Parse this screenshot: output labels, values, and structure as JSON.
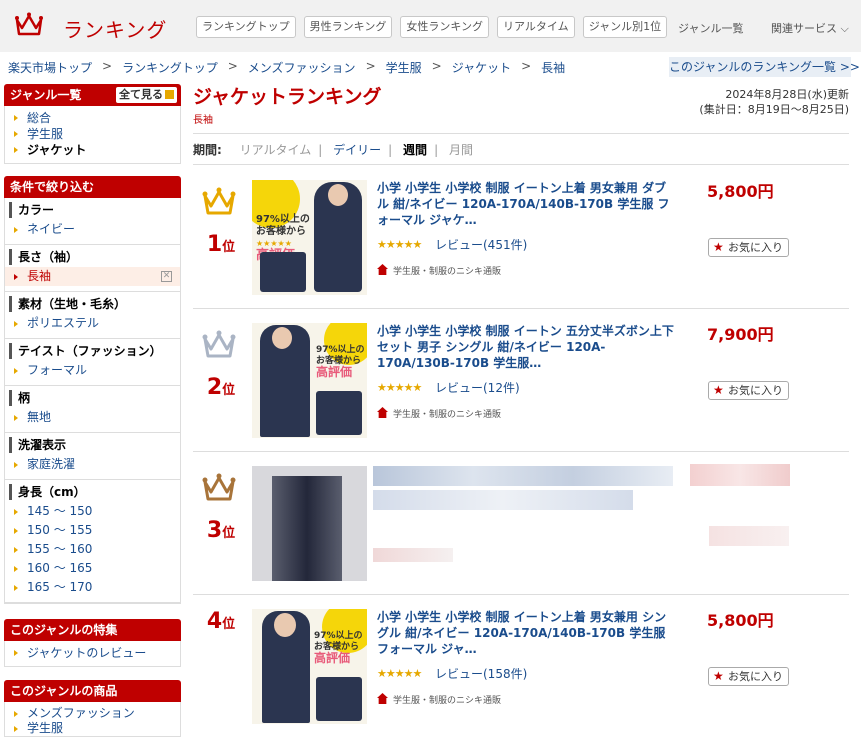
{
  "header": {
    "logo_text": "ランキング",
    "nav": [
      "ランキングトップ",
      "男性ランキング",
      "女性ランキング",
      "リアルタイム",
      "ジャンル別1位"
    ],
    "genre_list": "ジャンル一覧",
    "related": "関連サービス"
  },
  "breadcrumb": [
    "楽天市場トップ",
    "ランキングトップ",
    "メンズファッション",
    "学生服",
    "ジャケット",
    "長袖"
  ],
  "genre_rank_list_button": "このジャンルのランキング一覧 >>",
  "sidebar": {
    "genre_header": "ジャンル一覧",
    "see_all": "全て見る",
    "genres": [
      "総合",
      "学生服",
      "ジャケット"
    ],
    "filter_header": "条件で絞り込む",
    "filters": [
      {
        "title": "カラー",
        "items": [
          "ネイビー"
        ]
      },
      {
        "title": "長さ（袖）",
        "items": [
          "長袖"
        ]
      },
      {
        "title": "素材（生地・毛糸）",
        "items": [
          "ポリエステル"
        ]
      },
      {
        "title": "テイスト（ファッション）",
        "items": [
          "フォーマル"
        ]
      },
      {
        "title": "柄",
        "items": [
          "無地"
        ]
      },
      {
        "title": "洗濯表示",
        "items": [
          "家庭洗濯"
        ]
      },
      {
        "title": "身長（cm）",
        "items": [
          "145 ～ 150",
          "150 ～ 155",
          "155 ～ 160",
          "160 ～ 165",
          "165 ～ 170"
        ]
      }
    ],
    "special_header": "このジャンルの特集",
    "special_items": [
      "ジャケットのレビュー"
    ],
    "products_header": "このジャンルの商品",
    "products_items": [
      "メンズファッション",
      "学生服"
    ]
  },
  "main": {
    "title": "ジャケットランキング",
    "subtitle": "長袖",
    "updated": "2024年8月28日(水)更新",
    "aggregation": "(集計日：8月19日～8月25日)",
    "period_label": "期間:",
    "periods": [
      "リアルタイム",
      "デイリー",
      "週間",
      "月間"
    ],
    "items": [
      {
        "rank": "1",
        "rank_suffix": "位",
        "title": "小学 小学生 小学校 制服 イートン上着 男女兼用 ダブル 紺/ネイビー 120A-170A/140B-170B 学生服 フォーマル ジャケ…",
        "reviews": "レビュー(451件)",
        "shop": "学生服・制服のニシキ通販",
        "price": "5,800円",
        "fav": "お気に入り"
      },
      {
        "rank": "2",
        "rank_suffix": "位",
        "title": "小学 小学生 小学校 制服 イートン 五分丈半ズボン上下セット 男子 シングル 紺/ネイビー 120A-170A/130B-170B 学生服…",
        "reviews": "レビュー(12件)",
        "shop": "学生服・制服のニシキ通販",
        "price": "7,900円",
        "fav": "お気に入り"
      },
      {
        "rank": "3",
        "rank_suffix": "位"
      },
      {
        "rank": "4",
        "rank_suffix": "位",
        "title": "小学 小学生 小学校 制服 イートン上着 男女兼用 シングル 紺/ネイビー 120A-170A/140B-170B 学生服 フォーマル ジャ…",
        "reviews": "レビュー(158件)",
        "shop": "学生服・制服のニシキ通販",
        "price": "5,800円",
        "fav": "お気に入り"
      }
    ],
    "thumb_badge": {
      "pct": "97%以上の",
      "line2": "お客様から",
      "line3": "高評価"
    },
    "stars": "★★★★★"
  },
  "colors": {
    "brand": "#bf0000",
    "link": "#1a4c8c",
    "gold": "#e6a800"
  }
}
